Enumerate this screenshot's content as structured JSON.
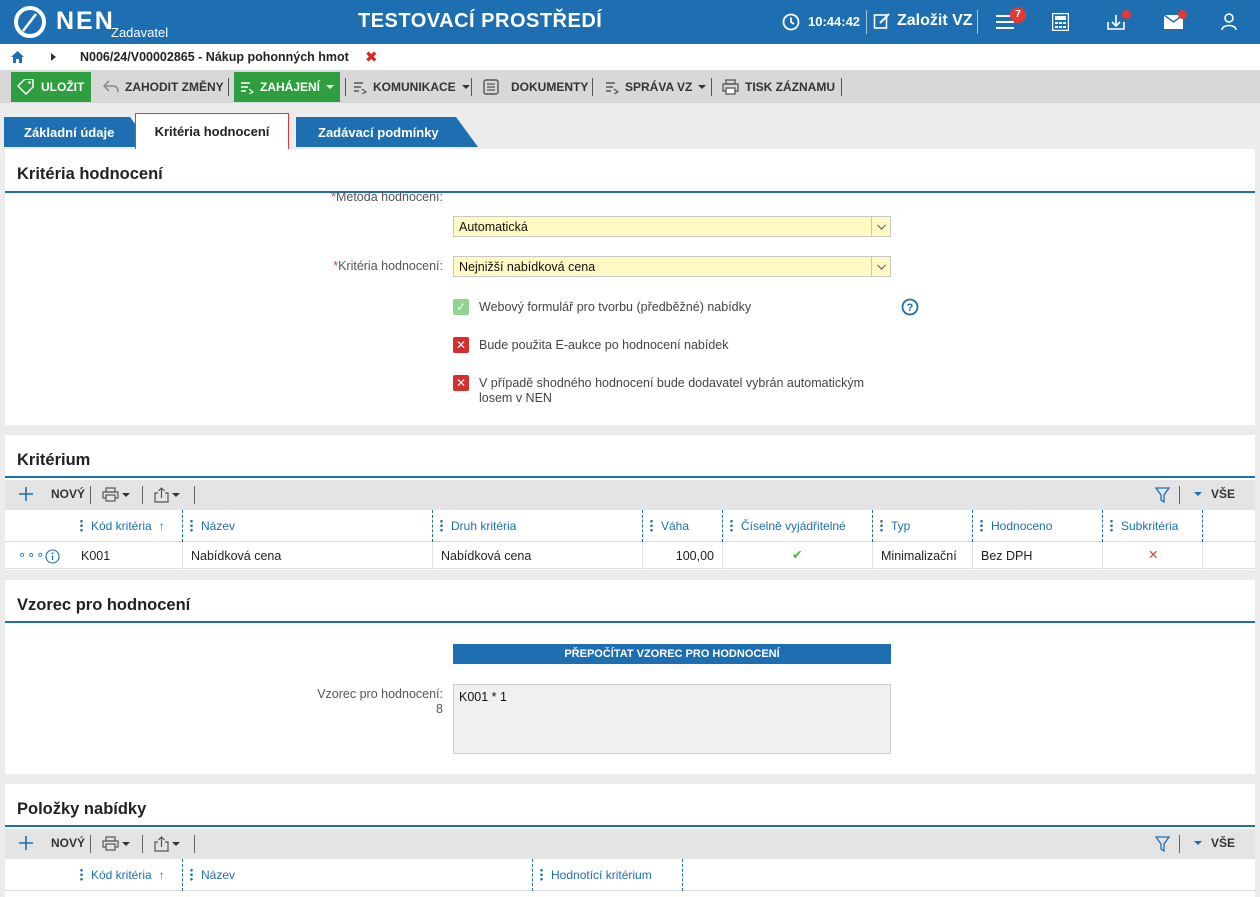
{
  "header": {
    "brand": "NEN",
    "brand_sub": "Zadavatel",
    "environment": "TESTOVACÍ PROSTŘEDÍ",
    "clock": "10:44:42",
    "create_label": "Založit VZ",
    "notification_count": "7"
  },
  "breadcrumb": {
    "title": "N006/24/V00002865 - Nákup pohonných hmot",
    "close": "✖"
  },
  "toolbar": {
    "save": "ULOŽIT",
    "discard": "ZAHODIT ZMĚNY",
    "start": "ZAHÁJENÍ",
    "communication": "KOMUNIKACE",
    "documents": "DOKUMENTY",
    "management": "SPRÁVA VZ",
    "print": "TISK ZÁZNAMU"
  },
  "tabs": [
    "Základní údaje",
    "Kritéria hodnocení",
    "Zadávací podmínky"
  ],
  "criteria_section": {
    "title": "Kritéria hodnocení",
    "method_label": "Metoda hodnocení:",
    "method_value": "Automatická",
    "criteria_label": "Kritéria hodnocení:",
    "criteria_value": "Nejnižší nabídková cena",
    "web_form_label": "Webový formulář pro tvorbu (předběžné) nabídky",
    "eauction_label": "Bude použita E-aukce po hodnocení nabídek",
    "tie_label": "V případě shodného hodnocení bude dodavatel vybrán automatickým losem v NEN"
  },
  "criterion_grid": {
    "title": "Kritérium",
    "new_label": "NOVÝ",
    "all_label": "VŠE",
    "columns": [
      "Kód kritéria",
      "Název",
      "Druh kritéria",
      "Váha",
      "Číselně vyjádřitelné",
      "Typ",
      "Hodnoceno",
      "Subkritéria"
    ],
    "rows": [
      {
        "code": "K001",
        "name": "Nabídková cena",
        "kind": "Nabídková cena",
        "weight": "100,00",
        "numeric": "✔",
        "type": "Minimalizační",
        "evaluated": "Bez DPH",
        "sub": "✕"
      }
    ]
  },
  "formula_section": {
    "title": "Vzorec pro hodnocení",
    "recalc_button": "PŘEPOČÍTAT VZOREC PRO HODNOCENÍ",
    "formula_label": "Vzorec pro hodnocení:",
    "formula_number": "8",
    "formula_value": "K001 * 1"
  },
  "items_grid": {
    "title": "Položky nabídky",
    "new_label": "NOVÝ",
    "all_label": "VŠE",
    "columns": [
      "Kód kritéria",
      "Název",
      "Hodnotící kritérium"
    ]
  },
  "colors": {
    "primary": "#1d6fb2",
    "save_green": "#2e9e3e",
    "select_yellow": "#fff9c4",
    "alert_red": "#e53935",
    "check_green": "#4caf50"
  }
}
